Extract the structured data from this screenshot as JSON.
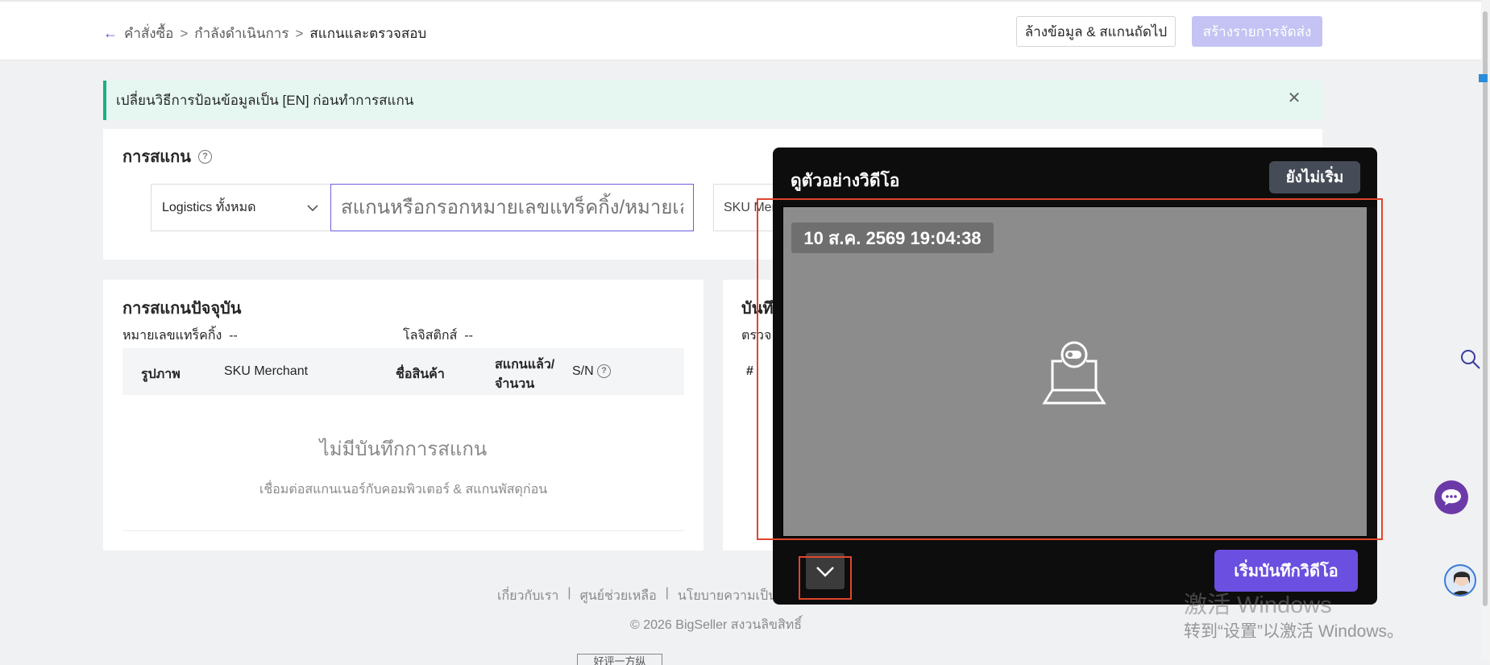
{
  "breadcrumb": {
    "back_icon": "arrow-left-icon",
    "items": [
      "คำสั่งซื้อ",
      "กำลังดำเนินการ",
      "สแกนและตรวจสอบ"
    ],
    "separator": ">"
  },
  "header": {
    "clear_button": "ล้างข้อมูล & สแกนถัดไป",
    "create_button": "สร้างรายการจัดส่ง"
  },
  "alert": {
    "text": "เปลี่ยนวิธีการป้อนข้อมูลเป็น [EN] ก่อนทำการสแกน",
    "close_icon": "close-icon"
  },
  "scan": {
    "title": "การสแกน",
    "help_icon": "help-circle-icon",
    "logistics_select": "Logistics ทั้งหมด",
    "input_placeholder": "สแกนหรือกรอกหมายเลขแทร็คกิ้ง/หมายเล",
    "sku_field": "SKU Merchant"
  },
  "current_scan": {
    "title": "การสแกนปัจจุบัน",
    "tracking_label": "หมายเลขแทร็คกิ้ง",
    "tracking_value": "--",
    "logistics_label": "โลจิสติกส์",
    "logistics_value": "--",
    "columns": {
      "image": "รูปภาพ",
      "sku": "SKU Merchant",
      "product": "ชื่อสินค้า",
      "scanned_line1": "สแกนแล้ว/",
      "scanned_line2": "จำนวน",
      "sn": "S/N"
    },
    "empty_title": "ไม่มีบันทึกการสแกน",
    "empty_subtitle": "เชื่อมต่อสแกนเนอร์กับคอมพิวเตอร์ & สแกนพัสดุก่อน"
  },
  "record_card": {
    "title_partial": "บันทึ",
    "sub_partial": "ตรวจ",
    "col_partial": "#"
  },
  "video_preview": {
    "title": "ดูตัวอย่างวิดีโอ",
    "status": "ยังไม่เริ่ม",
    "timestamp": "10 ส.ค. 2569 19:04:38",
    "camera_icon": "webcam-icon",
    "collapse_icon": "chevron-down-icon",
    "start_button": "เริ่มบันทึกวิดีโอ"
  },
  "footer": {
    "links": [
      "เกี่ยวกับเรา",
      "|",
      "ศูนย์ช่วยเหลือ",
      "|",
      "นโยบายความเป็นส่ว"
    ],
    "copyright": "© 2026 BigSeller สงวนลิขสิทธิ์",
    "bottom_text": "好评一方纵"
  },
  "watermark": {
    "line1": "激活 Windows",
    "line2": "转到“设置”以激活 Windows。"
  },
  "colors": {
    "accent": "#6a4fe0",
    "alert_border": "#19b27e",
    "highlight_frame": "#e0452d"
  }
}
